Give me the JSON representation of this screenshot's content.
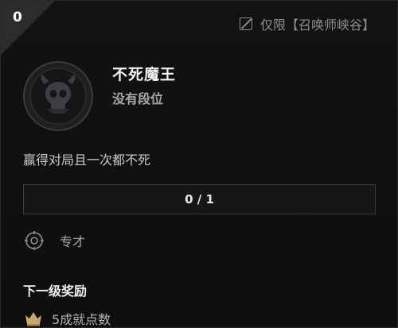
{
  "badge": {
    "count": "0"
  },
  "scope": {
    "label": "仅限【召唤师峡谷】",
    "icon": "map-restricted-icon"
  },
  "challenge": {
    "title": "不死魔王",
    "rank": "没有段位",
    "description": "赢得对局且一次都不死",
    "progress": {
      "text": "0 / 1",
      "current": 0,
      "total": 1
    },
    "category": {
      "label": "专才",
      "icon": "target-icon"
    }
  },
  "reward": {
    "heading": "下一级奖励",
    "item": {
      "label": "5成就点数",
      "icon": "crown-icon"
    }
  },
  "colors": {
    "accent": "#c8a870",
    "text": "#f2f2f2",
    "muted": "#a8a8a8"
  }
}
